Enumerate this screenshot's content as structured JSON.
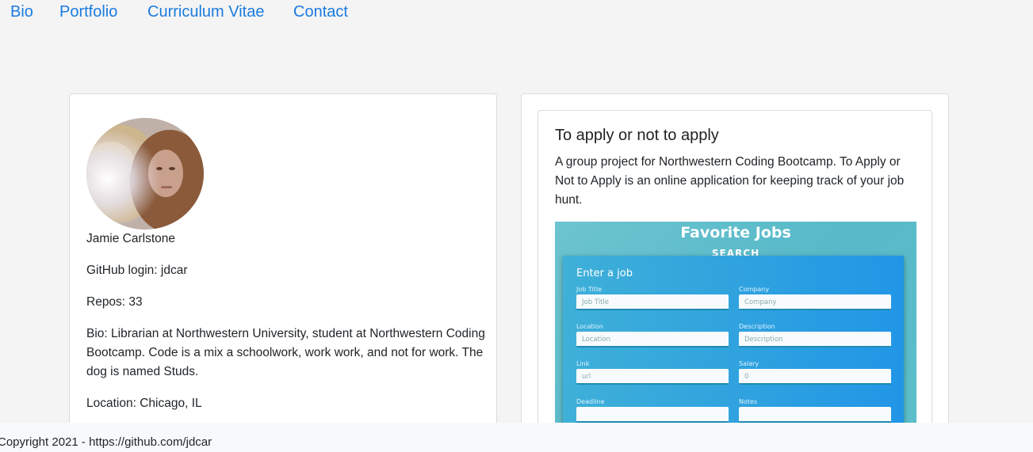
{
  "nav": {
    "items": [
      "Bio",
      "Portfolio",
      "Curriculum Vitae",
      "Contact"
    ]
  },
  "profile": {
    "name": "Jamie Carlstone",
    "github_login": "GitHub login: jdcar",
    "repos": "Repos: 33",
    "bio": "Bio: Librarian at Northwestern University, student at Northwestern Coding Bootcamp. Code is a mix a schoolwork, work work, and not for work. The dog is named Studs.",
    "location": "Location: Chicago, IL"
  },
  "project": {
    "title": "To apply or not to apply",
    "description": "A group project for Northwestern Coding Bootcamp. To Apply or Not to Apply is an online application for keeping track of your job hunt.",
    "screenshot": {
      "title": "Favorite Jobs",
      "search": "SEARCH",
      "form_heading": "Enter a job",
      "fields": [
        {
          "label": "Job Title",
          "placeholder": "Job Title"
        },
        {
          "label": "Company",
          "placeholder": "Company"
        },
        {
          "label": "Location",
          "placeholder": "Location"
        },
        {
          "label": "Description",
          "placeholder": "Description"
        },
        {
          "label": "Link",
          "placeholder": "url"
        },
        {
          "label": "Salary",
          "placeholder": "0"
        },
        {
          "label": "Deadline",
          "placeholder": ""
        },
        {
          "label": "Notes",
          "placeholder": ""
        }
      ]
    }
  },
  "footer": {
    "text": "Copyright 2021 - https://github.com/jdcar"
  }
}
